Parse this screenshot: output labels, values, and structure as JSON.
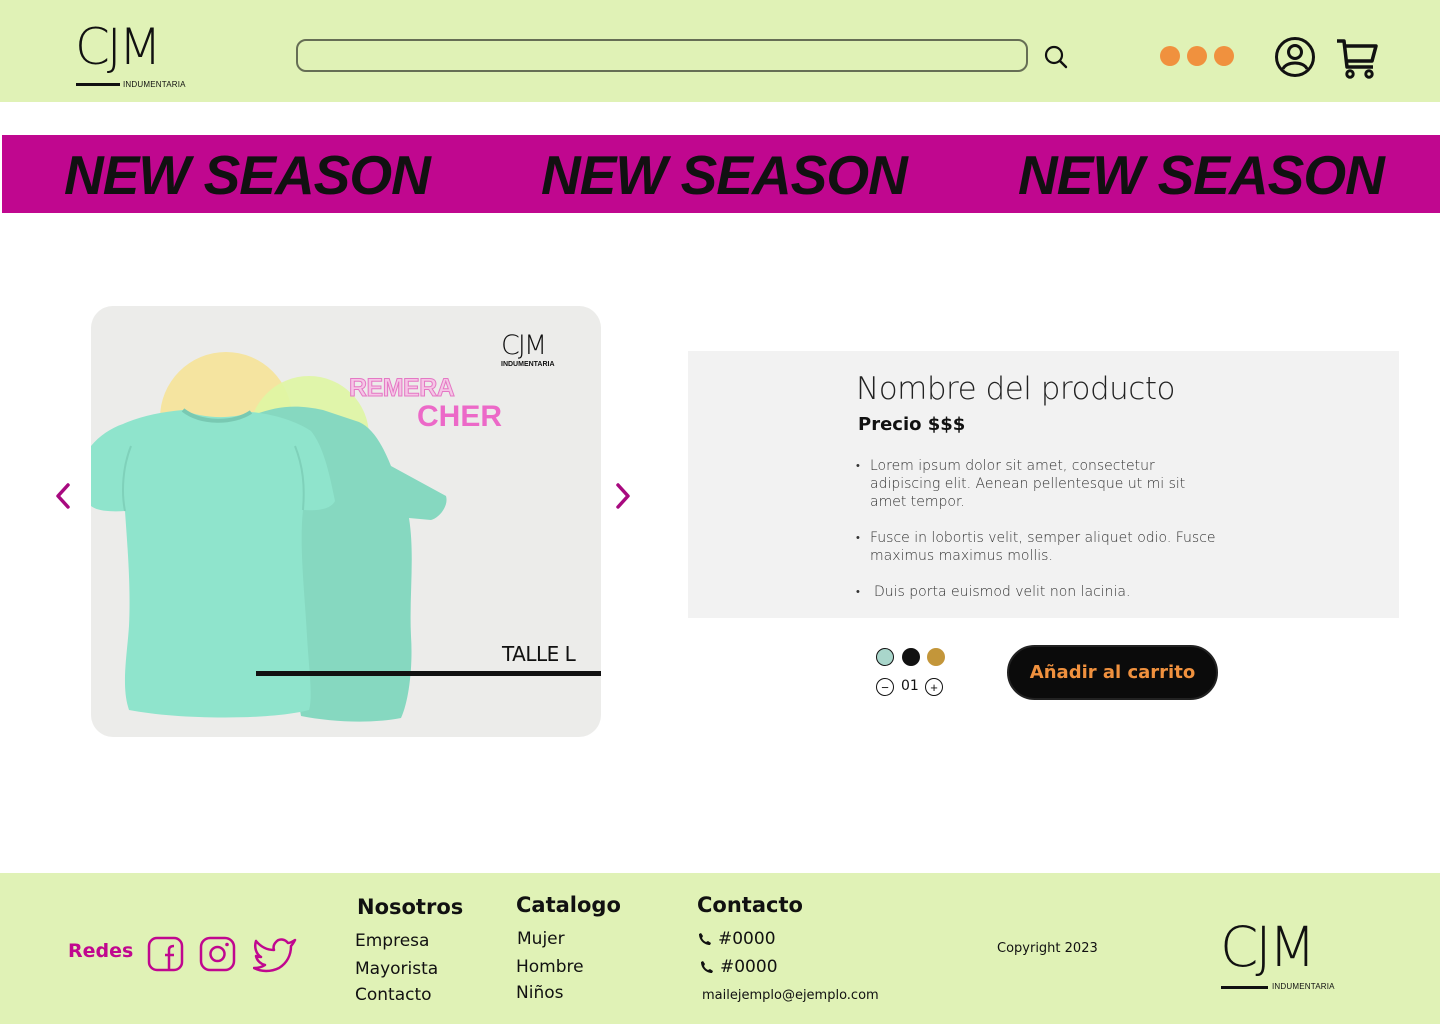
{
  "header": {
    "logo": {
      "mark": "CJM",
      "sub": "INDUMENTARIA"
    },
    "search": {
      "placeholder": ""
    },
    "icons": {
      "search": "search-icon",
      "more": "more-dots-icon",
      "account": "user-icon",
      "cart": "cart-icon"
    }
  },
  "banner": {
    "items": [
      "NEW SEASON",
      "NEW SEASON",
      "NEW SEASON"
    ]
  },
  "gallery": {
    "brand_mark": "CJM",
    "brand_sub": "INDUMENTARIA",
    "product_line1": "REMERA",
    "product_line2": "CHER",
    "size_label": "TALLE L",
    "prev_icon": "chevron-left-icon",
    "next_icon": "chevron-right-icon"
  },
  "product": {
    "name": "Nombre del producto",
    "price": "Precio $$$",
    "bullets": [
      "Lorem ipsum dolor sit amet, consectetur adipiscing elit. Aenean pellentesque ut mi sit amet tempor.",
      "Fusce in lobortis velit, semper aliquet odio. Fusce maximus maximus mollis.",
      "Duis porta euismod velit non lacinia."
    ],
    "colors": [
      "#a9d6cb",
      "#111111",
      "#c3963a"
    ],
    "quantity": "01",
    "add_to_cart": "Añadir al carrito"
  },
  "footer": {
    "redes_label": "Redes",
    "social": [
      "facebook-icon",
      "instagram-icon",
      "twitter-icon"
    ],
    "nosotros": {
      "title": "Nosotros",
      "links": [
        "Empresa",
        "Mayorista",
        "Contacto"
      ]
    },
    "catalogo": {
      "title": "Catalogo",
      "links": [
        "Mujer",
        "Hombre",
        "Niños"
      ]
    },
    "contacto": {
      "title": "Contacto",
      "phones": [
        "#0000",
        "#0000"
      ],
      "email": "mailejemplo@ejemplo.com"
    },
    "copyright": "Copyright 2023",
    "logo": {
      "mark": "CJM",
      "sub": "INDUMENTARIA"
    }
  },
  "colors": {
    "header_bg": "#e0f2b6",
    "banner_bg": "#c0078f",
    "accent_orange": "#f0913e",
    "accent_magenta": "#c0078f"
  }
}
